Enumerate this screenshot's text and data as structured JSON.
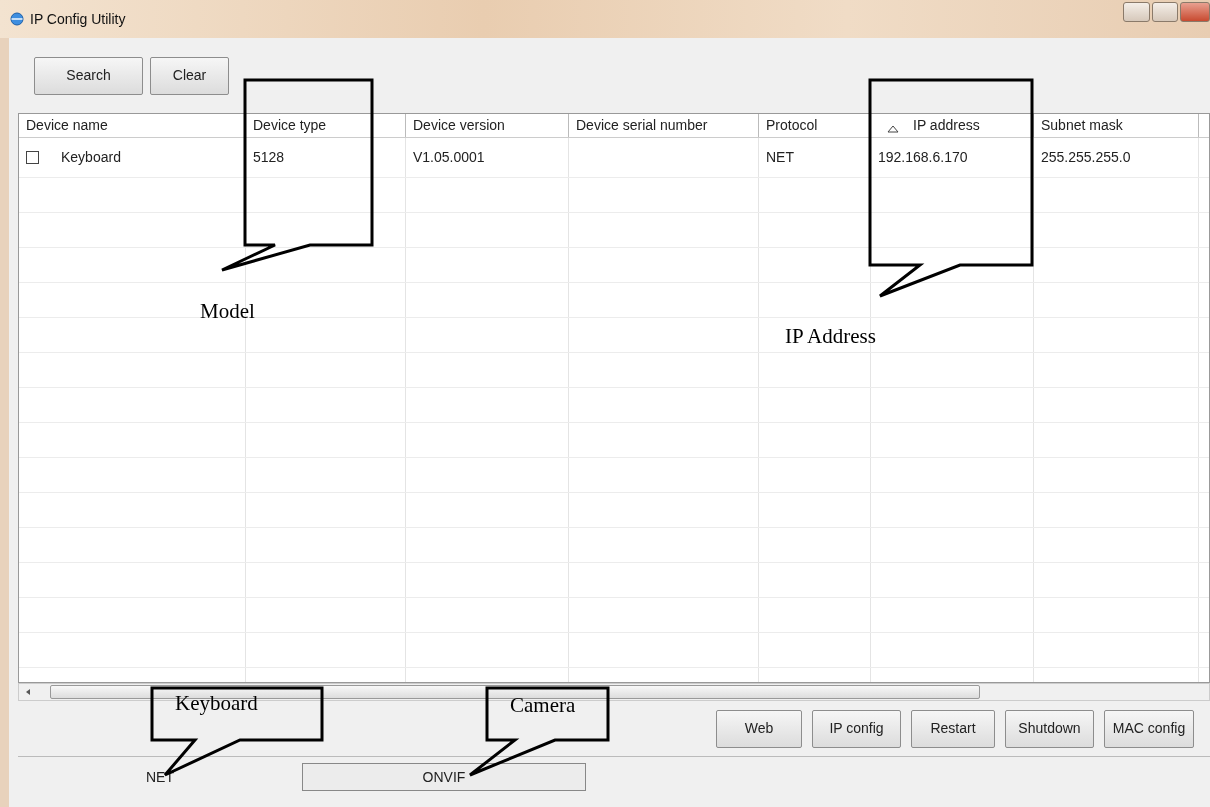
{
  "window": {
    "title": "IP Config Utility"
  },
  "toolbar": [
    "Search",
    "Clear"
  ],
  "table": {
    "columns": [
      {
        "label": "Device name",
        "sorted": false
      },
      {
        "label": "Device type",
        "sorted": false
      },
      {
        "label": "Device version",
        "sorted": false
      },
      {
        "label": "Device serial number",
        "sorted": false
      },
      {
        "label": "Protocol",
        "sorted": false
      },
      {
        "label": "IP address",
        "sorted": true
      },
      {
        "label": "Subnet mask",
        "sorted": false
      }
    ],
    "rows": [
      {
        "checked": false,
        "cells": [
          "Keyboard",
          "5128",
          "V1.05.0001",
          null,
          "NET",
          "192.168.6.170",
          "255.255.255.0"
        ]
      }
    ]
  },
  "actions": [
    "Web",
    "IP config",
    "Restart",
    "Shutdown",
    "MAC config"
  ],
  "tabs": [
    {
      "label": "NET",
      "selected": true
    },
    {
      "label": "ONVIF",
      "selected": false
    }
  ],
  "annotations": [
    {
      "text": "Model"
    },
    {
      "text": "IP Address"
    },
    {
      "text": "Keyboard"
    },
    {
      "text": "Camera"
    }
  ]
}
